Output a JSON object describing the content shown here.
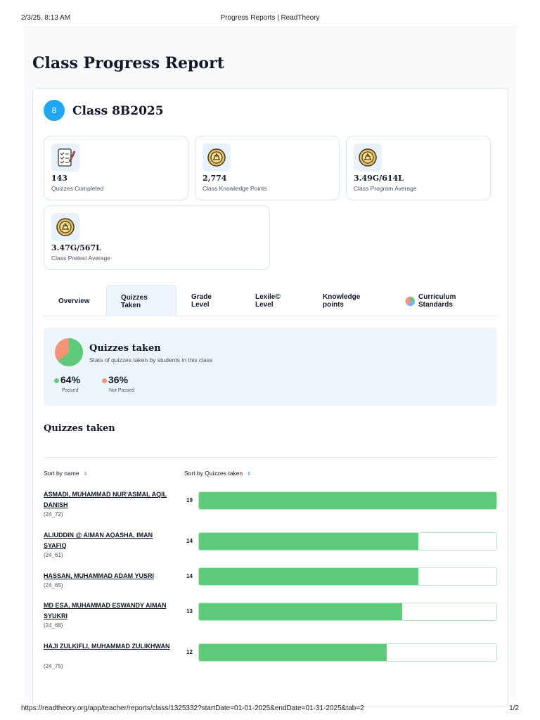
{
  "print_header": {
    "date": "2/3/25, 8:13 AM",
    "title": "Progress Reports | ReadTheory"
  },
  "print_footer": {
    "url": "https://readtheory.org/app/teacher/reports/class/1325332?startDate=01-01-2025&endDate=01-31-2025&tab=2",
    "page": "1/2"
  },
  "page_title": "Class Progress Report",
  "class": {
    "badge": "8",
    "name": "Class 8B2025"
  },
  "stats": [
    {
      "value": "143",
      "label": "Quizzes Completed",
      "icon": "checklist-icon"
    },
    {
      "value": "2,774",
      "label": "Class Knowledge Points",
      "icon": "medal-icon"
    },
    {
      "value": "3.49G/614L",
      "label": "Class Program Average",
      "icon": "medal-icon"
    },
    {
      "value": "3.47G/567L",
      "label": "Class Pretest Average",
      "icon": "medal-icon"
    }
  ],
  "tabs": [
    {
      "label": "Overview"
    },
    {
      "label": "Quizzes\nTaken",
      "active": true
    },
    {
      "label": "Grade\nLevel"
    },
    {
      "label": "Lexile©\nLevel"
    },
    {
      "label": "Knowledge\npoints"
    },
    {
      "label": "Curriculum\nStandards",
      "icon": "pie-chart-icon"
    }
  ],
  "summary": {
    "title": "Quizzes taken",
    "subtitle": "Stats of quizzes taken by students in this class",
    "passed_pct": "64%",
    "passed_label": "Passed",
    "not_passed_pct": "36%",
    "not_passed_label": "Not Passed",
    "passed_fraction": 0.64,
    "colors": {
      "passed": "#5ecb7a",
      "not_passed": "#f59377"
    }
  },
  "section_title": "Quizzes taken",
  "sort": {
    "by_name": "Sort by name",
    "by_quizzes": "Sort by Quizzes taken"
  },
  "max_quizzes": 19,
  "students": [
    {
      "name": "ASMADI, MUHAMMAD NUR'ASMAL AQIL DANISH",
      "id": "(24_72)",
      "quizzes": 19
    },
    {
      "name": "ALIUDDIN @ AIMAN AQASHA, IMAN SYAFIQ",
      "id": "(24_61)",
      "quizzes": 14
    },
    {
      "name": "HASSAN, MUHAMMAD ADAM YUSRI",
      "id": "(24_65)",
      "quizzes": 14
    },
    {
      "name": "MD ESA, MUHAMMAD ESWANDY AIMAN SYUKRI",
      "id": "(24_68)",
      "quizzes": 13
    },
    {
      "name": "HAJI ZULKIFLI, MUHAMMAD ZULIKHWAN",
      "id": "(24_75)",
      "quizzes": 12
    }
  ]
}
